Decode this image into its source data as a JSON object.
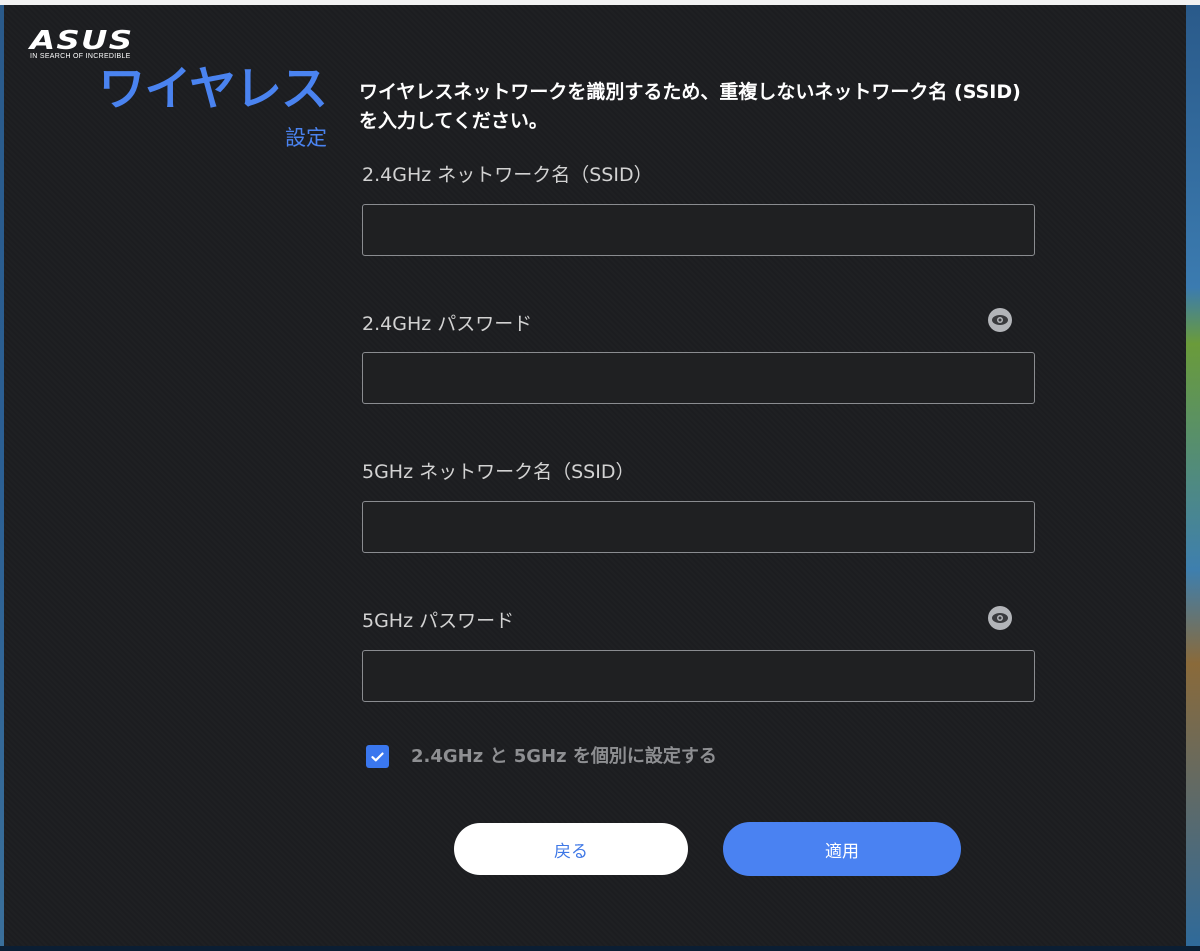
{
  "brand": {
    "logo_text": "ASUS",
    "tagline": "IN SEARCH OF INCREDIBLE"
  },
  "header": {
    "title": "ワイヤレス",
    "subtitle": "設定"
  },
  "intro_text": "ワイヤレスネットワークを識別するため、重複しないネットワーク名 (SSID) を入力してください。",
  "fields": [
    {
      "label": "2.4GHz ネットワーク名（SSID）",
      "value": "",
      "placeholder": ""
    },
    {
      "label": "2.4GHz パスワード",
      "value": "",
      "placeholder": ""
    },
    {
      "label": "5GHz ネットワーク名（SSID）",
      "value": "",
      "placeholder": ""
    },
    {
      "label": "5GHz パスワード",
      "value": "",
      "placeholder": ""
    }
  ],
  "separate_bands": {
    "label": "2.4GHz と 5GHz を個別に設定する",
    "checked": true
  },
  "buttons": {
    "back": "戻る",
    "apply": "適用"
  },
  "colors": {
    "accent": "#4a83f0",
    "background": "#1c1d20",
    "input_border": "#8a8c90",
    "label_text": "#d2d2d2"
  }
}
